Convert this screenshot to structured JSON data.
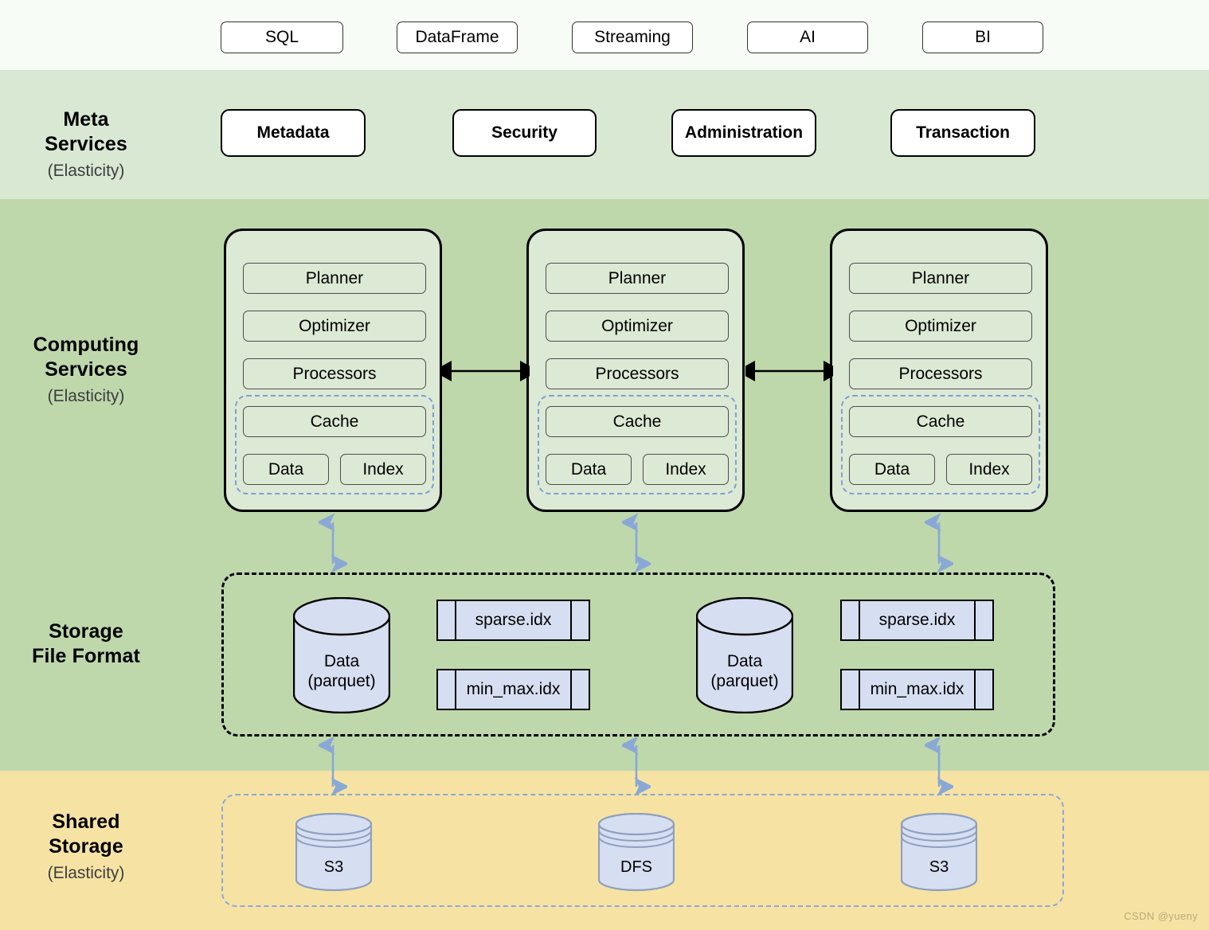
{
  "colors": {
    "band_access": "#f7fcf6",
    "band_meta": "#d8e8d3",
    "band_compute": "#bed8ac",
    "band_shared": "#f6e3a4",
    "node_fill": "#dce9d5",
    "cylinder_fill": "#d6dff1",
    "dashed_blue": "#7e9fd2",
    "arrow_blue": "#8aa8d6",
    "arrow_black": "#000000"
  },
  "access_layer": {
    "items": [
      {
        "label": "SQL"
      },
      {
        "label": "DataFrame"
      },
      {
        "label": "Streaming"
      },
      {
        "label": "AI"
      },
      {
        "label": "BI"
      }
    ]
  },
  "meta_services": {
    "title": "Meta Services",
    "title_line1": "Meta",
    "title_line2": "Services",
    "subtitle": "(Elasticity)",
    "items": [
      {
        "label": "Metadata"
      },
      {
        "label": "Security"
      },
      {
        "label": "Administration"
      },
      {
        "label": "Transaction"
      }
    ]
  },
  "computing_services": {
    "title_line1": "Computing",
    "title_line2": "Services",
    "subtitle": "(Elasticity)",
    "nodes": [
      {
        "parts": [
          "Planner",
          "Optimizer",
          "Processors"
        ],
        "cache": {
          "label": "Cache",
          "items": [
            "Data",
            "Index"
          ]
        }
      },
      {
        "parts": [
          "Planner",
          "Optimizer",
          "Processors"
        ],
        "cache": {
          "label": "Cache",
          "items": [
            "Data",
            "Index"
          ]
        }
      },
      {
        "parts": [
          "Planner",
          "Optimizer",
          "Processors"
        ],
        "cache": {
          "label": "Cache",
          "items": [
            "Data",
            "Index"
          ]
        }
      }
    ]
  },
  "storage_file_format": {
    "title_line1": "Storage",
    "title_line2": "File Format",
    "groups": [
      {
        "data_cylinder": {
          "line1": "Data",
          "line2": "(parquet)"
        },
        "indexes": [
          "sparse.idx",
          "min_max.idx"
        ]
      },
      {
        "data_cylinder": {
          "line1": "Data",
          "line2": "(parquet)"
        },
        "indexes": [
          "sparse.idx",
          "min_max.idx"
        ]
      }
    ]
  },
  "shared_storage": {
    "title_line1": "Shared",
    "title_line2": "Storage",
    "subtitle": "(Elasticity)",
    "items": [
      {
        "label": "S3"
      },
      {
        "label": "DFS"
      },
      {
        "label": "S3"
      }
    ]
  },
  "watermark": "CSDN @yueny"
}
